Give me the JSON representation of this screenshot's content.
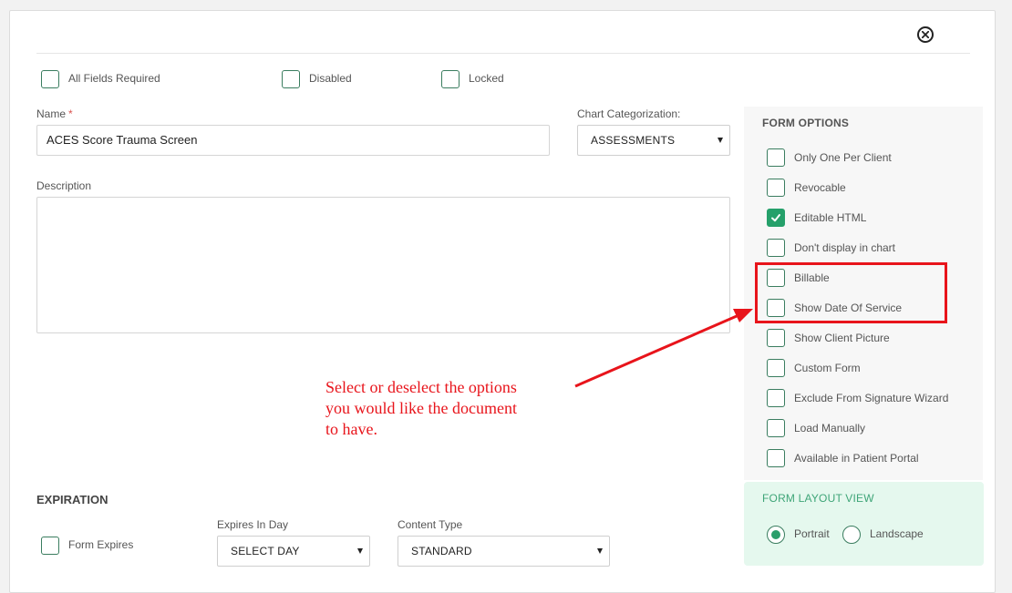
{
  "toggles": {
    "all_fields_required": "All Fields Required",
    "disabled": "Disabled",
    "locked": "Locked"
  },
  "name_field": {
    "label": "Name",
    "required_marker": "*",
    "value": "ACES Score Trauma Screen"
  },
  "chart_categorization": {
    "label": "Chart Categorization:",
    "value": "ASSESSMENTS"
  },
  "description": {
    "label": "Description",
    "value": ""
  },
  "form_options": {
    "title": "FORM OPTIONS",
    "items": [
      {
        "label": "Only One Per Client",
        "checked": false
      },
      {
        "label": "Revocable",
        "checked": false
      },
      {
        "label": "Editable HTML",
        "checked": true
      },
      {
        "label": "Don't display in chart",
        "checked": false
      },
      {
        "label": "Billable",
        "checked": false
      },
      {
        "label": "Show Date Of Service",
        "checked": false
      },
      {
        "label": "Show Client Picture",
        "checked": false
      },
      {
        "label": "Custom Form",
        "checked": false
      },
      {
        "label": "Exclude From Signature Wizard",
        "checked": false
      },
      {
        "label": "Load Manually",
        "checked": false
      },
      {
        "label": "Available in Patient Portal",
        "checked": false
      }
    ]
  },
  "form_layout": {
    "title": "FORM LAYOUT VIEW",
    "portrait": "Portrait",
    "landscape": "Landscape",
    "selected": "Portrait"
  },
  "expiration": {
    "title": "EXPIRATION",
    "form_expires": "Form Expires",
    "expires_in_day_label": "Expires In Day",
    "expires_in_day_value": "SELECT DAY",
    "content_type_label": "Content Type",
    "content_type_value": "STANDARD"
  },
  "annotation": {
    "line1": "Select or deselect the options",
    "line2": "you would like the document",
    "line3": "to have."
  },
  "colors": {
    "accent_green": "#25a06a",
    "annotation_red": "#e8141b",
    "layout_bg": "#e5f8ee"
  }
}
